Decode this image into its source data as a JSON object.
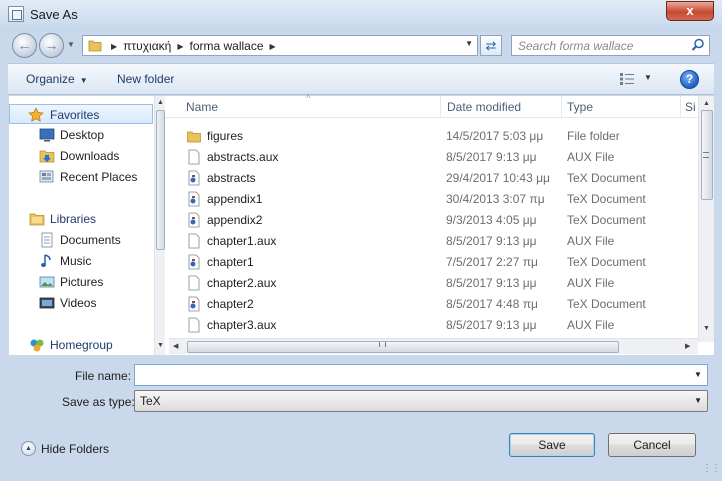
{
  "window": {
    "title": "Save As",
    "close_label": "x"
  },
  "address": {
    "crumbs": [
      "πτυχιακή",
      "forma wallace"
    ],
    "search_placeholder": "Search forma wallace"
  },
  "toolbar": {
    "organize": "Organize",
    "new_folder": "New folder",
    "help": "?"
  },
  "navigation": [
    {
      "label": "Favorites",
      "icon": "star-icon",
      "group": true,
      "selected": true
    },
    {
      "label": "Desktop",
      "icon": "desktop-icon"
    },
    {
      "label": "Downloads",
      "icon": "downloads-folder-icon"
    },
    {
      "label": "Recent Places",
      "icon": "recent-places-icon"
    },
    {
      "label": "Libraries",
      "icon": "libraries-icon",
      "group": true
    },
    {
      "label": "Documents",
      "icon": "documents-icon"
    },
    {
      "label": "Music",
      "icon": "music-icon"
    },
    {
      "label": "Pictures",
      "icon": "pictures-icon"
    },
    {
      "label": "Videos",
      "icon": "videos-icon"
    },
    {
      "label": "Homegroup",
      "icon": "homegroup-icon",
      "group": true
    }
  ],
  "columns": {
    "name": "Name",
    "date": "Date modified",
    "type": "Type",
    "size": "Si"
  },
  "files": [
    {
      "name": "figures",
      "date": "14/5/2017 5:03 μμ",
      "type": "File folder",
      "icon": "folder-icon"
    },
    {
      "name": "abstracts.aux",
      "date": "8/5/2017 9:13 μμ",
      "type": "AUX File",
      "icon": "file-icon"
    },
    {
      "name": "abstracts",
      "date": "29/4/2017 10:43 μμ",
      "type": "TeX Document",
      "icon": "tex-document-icon"
    },
    {
      "name": "appendix1",
      "date": "30/4/2013 3:07 πμ",
      "type": "TeX Document",
      "icon": "tex-document-icon"
    },
    {
      "name": "appendix2",
      "date": "9/3/2013 4:05 μμ",
      "type": "TeX Document",
      "icon": "tex-document-icon"
    },
    {
      "name": "chapter1.aux",
      "date": "8/5/2017 9:13 μμ",
      "type": "AUX File",
      "icon": "file-icon"
    },
    {
      "name": "chapter1",
      "date": "7/5/2017 2:27 πμ",
      "type": "TeX Document",
      "icon": "tex-document-icon"
    },
    {
      "name": "chapter2.aux",
      "date": "8/5/2017 9:13 μμ",
      "type": "AUX File",
      "icon": "file-icon"
    },
    {
      "name": "chapter2",
      "date": "8/5/2017 4:48 πμ",
      "type": "TeX Document",
      "icon": "tex-document-icon"
    },
    {
      "name": "chapter3.aux",
      "date": "8/5/2017 9:13 μμ",
      "type": "AUX File",
      "icon": "file-icon"
    }
  ],
  "form": {
    "filename_label": "File name:",
    "filename_value": "",
    "savetype_label": "Save as type:",
    "savetype_value": "TeX"
  },
  "footer": {
    "hide_folders": "Hide Folders",
    "save": "Save",
    "cancel": "Cancel"
  },
  "colors": {
    "selection": "#d9e9fb",
    "link": "#1f3b66",
    "folder": "#e8c25a"
  }
}
